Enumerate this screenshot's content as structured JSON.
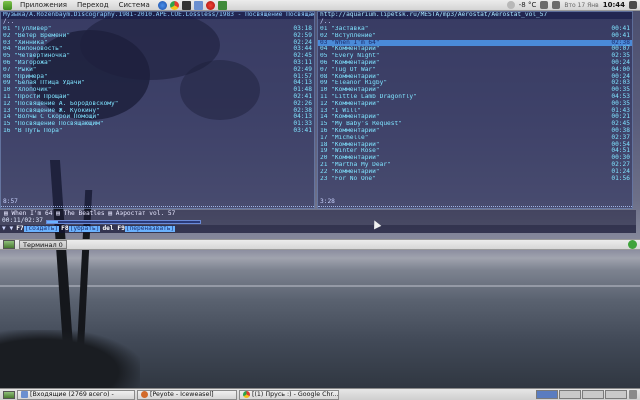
{
  "top_panel": {
    "menus": [
      "Приложения",
      "Переход",
      "Система"
    ],
    "temperature": "-8 °C",
    "date": "Вто 17 Янв",
    "clock": "10:44"
  },
  "terminal": {
    "left_pane": {
      "path": "Музыка/A.Rozenbaym.Discography.1981-2010.APE.CUE.Lossless/1983 - Посвящение Посвящающим",
      "up": "/..",
      "tracks": [
        {
          "name": "01 \"Гулливер\"",
          "dur": "03:18"
        },
        {
          "name": "02 \"Ветер Времени\"",
          "dur": "02:59"
        },
        {
          "name": "03 \"Хинника\"",
          "dur": "02:24"
        },
        {
          "name": "04 \"Вилоновость\"",
          "dur": "03:44"
        },
        {
          "name": "05 \"Четвертиночка\"",
          "dur": "02:45"
        },
        {
          "name": "06 \"Изгорожа\"",
          "dur": "03:11"
        },
        {
          "name": "07 \"Рыки\"",
          "dur": "02:49"
        },
        {
          "name": "08 \"Примера\"",
          "dur": "01:57"
        },
        {
          "name": "09 \"Белая Птица Удачи\"",
          "dur": "04:13"
        },
        {
          "name": "10 \"Хлопочик\"",
          "dur": "01:48"
        },
        {
          "name": "11 \"Прости Прощай\"",
          "dur": "02:41"
        },
        {
          "name": "12 \"Посвящение А. Бородовскому\"",
          "dur": "02:26"
        },
        {
          "name": "13 \"Посвящение Ж. Куокину\"",
          "dur": "02:38"
        },
        {
          "name": "14 \"Волчы С Скорой Помощи\"",
          "dur": "04:13"
        },
        {
          "name": "15 \"Посвящение Посвящающим\"",
          "dur": "01:33"
        },
        {
          "name": "16 \"В Путь Пора\"",
          "dur": "03:41"
        }
      ],
      "status": "8:57"
    },
    "right_pane": {
      "path": "http://aquarium.lipetsk.ru/MESTA/mp3/Aerostat/Aerostat_vol_57",
      "up": "/..",
      "tracks": [
        {
          "name": "01 \"Заставка\"",
          "dur": "00:41"
        },
        {
          "name": "02 \"Вступление\"",
          "dur": "00:41"
        },
        {
          "name": "03 \"When I'm 64\"",
          "dur": "02:38"
        },
        {
          "name": "04 \"Комментарии\"",
          "dur": "00:07"
        },
        {
          "name": "05 \"Every Night\"",
          "dur": "02:35"
        },
        {
          "name": "06 \"Комментарии\"",
          "dur": "00:24"
        },
        {
          "name": "07 \"Tug Of War\"",
          "dur": "04:00"
        },
        {
          "name": "08 \"Комментарии\"",
          "dur": "00:24"
        },
        {
          "name": "09 \"Eleanor Rigby\"",
          "dur": "02:03"
        },
        {
          "name": "10 \"Комментарии\"",
          "dur": "00:35"
        },
        {
          "name": "11 \"Little Lamb Dragonfly\"",
          "dur": "04:53"
        },
        {
          "name": "12 \"Комментарии\"",
          "dur": "00:35"
        },
        {
          "name": "13 \"I Will\"",
          "dur": "01:43"
        },
        {
          "name": "14 \"Комментарии\"",
          "dur": "00:21"
        },
        {
          "name": "15 \"My Baby's Request\"",
          "dur": "02:45"
        },
        {
          "name": "16 \"Комментарии\"",
          "dur": "00:38"
        },
        {
          "name": "17 \"Michelle\"",
          "dur": "02:37"
        },
        {
          "name": "18 \"Комментарии\"",
          "dur": "00:54"
        },
        {
          "name": "19 \"Winter Rose\"",
          "dur": "04:51"
        },
        {
          "name": "20 \"Комментарии\"",
          "dur": "00:30"
        },
        {
          "name": "21 \"Martha My Dear\"",
          "dur": "02:27"
        },
        {
          "name": "22 \"Комментарии\"",
          "dur": "01:24"
        },
        {
          "name": "23 \"For No One\"",
          "dur": "01:56"
        }
      ],
      "selected_index": 2,
      "status": "3:28"
    },
    "now_playing": "▤  When I'm 64 ▤  The Beatles ▤ Аэростат vol. 57",
    "progress": {
      "time": "00:11/02:37",
      "fraction": 0.07
    },
    "keybar": {
      "arrow": "▼ ▼",
      "keys": [
        {
          "key": "F7",
          "label": "[создать]"
        },
        {
          "key": "F8",
          "label": "[убрать]"
        },
        {
          "key": "del F9",
          "label": "[переназвать]"
        }
      ]
    }
  },
  "mid_panel": {
    "task": "Терминал 0"
  },
  "bottom_panel": {
    "tasks": [
      {
        "label": "[Входящие (2769 всего) -",
        "color": "#6a8fd0"
      },
      {
        "label": "[Peyote - Iceweasel]",
        "color": "#d26a2a"
      },
      {
        "label": "[(1) Прусь :) - Google Chr...",
        "color": "#3a8fd8"
      }
    ]
  }
}
